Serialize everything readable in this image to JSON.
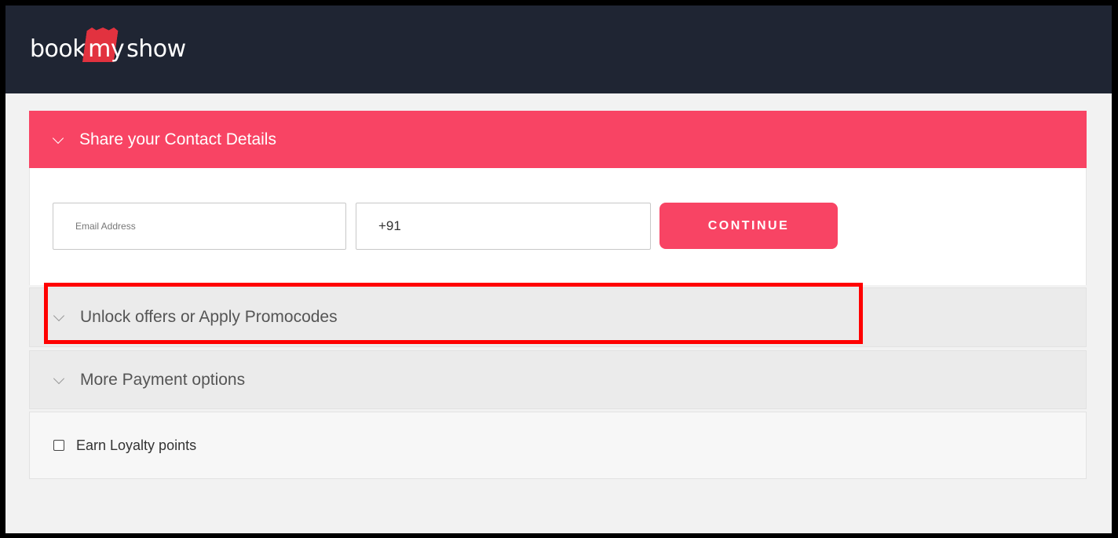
{
  "header": {
    "logo": {
      "part1": "book",
      "part2": "my",
      "part3": "show"
    }
  },
  "contact": {
    "title": "Share your Contact Details",
    "email_placeholder": "Email Address",
    "phone_prefix": "+91",
    "continue_label": "CONTINUE"
  },
  "offers": {
    "title": "Unlock offers or Apply Promocodes"
  },
  "payment": {
    "title": "More Payment options"
  },
  "loyalty": {
    "label": "Earn Loyalty points",
    "checked": false
  },
  "colors": {
    "brand": "#f84464",
    "topbar": "#1f2533",
    "highlight": "#ff0000"
  },
  "icons": [
    "chevron-down-icon",
    "checkbox-icon"
  ]
}
